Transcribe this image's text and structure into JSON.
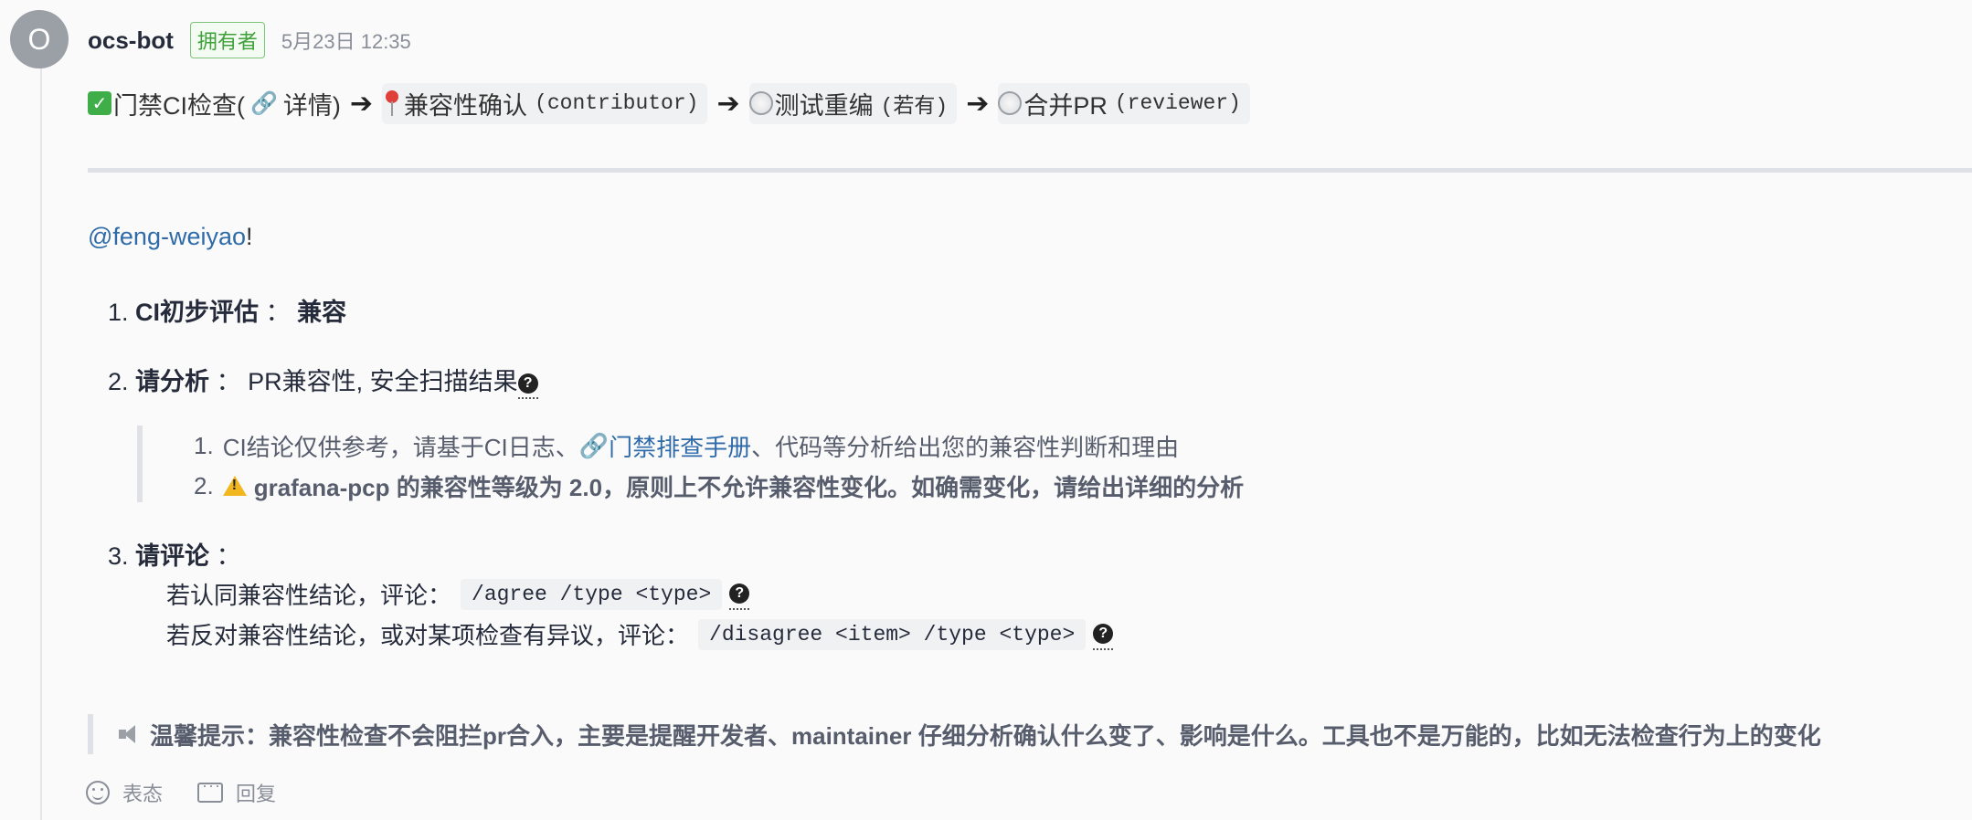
{
  "header": {
    "avatar_letter": "O",
    "author": "ocs-bot",
    "badge": "拥有者",
    "timestamp": "5月23日 12:35"
  },
  "pipeline": {
    "step1_label": "门禁CI检查(",
    "step1_link": "详情)",
    "step2_label": "兼容性确认",
    "step2_role": "(contributor)",
    "step3_label": "测试重编",
    "step3_role": "(若有)",
    "step4_label": "合并PR",
    "step4_role": "(reviewer)"
  },
  "mention": {
    "user": "@feng-weiyao",
    "suffix": "!"
  },
  "items": {
    "i1_num": "1.",
    "i1_title": "CI初步评估",
    "i1_sep": "：",
    "i1_value": "兼容",
    "i2_num": "2.",
    "i2_title": "请分析",
    "i2_sep": "：",
    "i2_value": "PR兼容性, 安全扫描结果",
    "i3_num": "3.",
    "i3_title": "请评论",
    "i3_sep": "："
  },
  "analysis": {
    "n1": "1.",
    "t1_a": "CI结论仅供参考，请基于CI日志、",
    "t1_link": "门禁排查手册",
    "t1_b": "、代码等分析给出您的兼容性判断和理由",
    "n2": "2.",
    "t2": "grafana-pcp 的兼容性等级为 2.0，原则上不允许兼容性变化。如确需变化，请给出详细的分析"
  },
  "comment_help": {
    "agree_prefix": "若认同兼容性结论，评论：",
    "agree_cmd": "/agree /type <type>",
    "disagree_prefix": "若反对兼容性结论，或对某项检查有异议，评论：",
    "disagree_cmd": "/disagree <item> /type <type>"
  },
  "tip": {
    "text": "温馨提示：兼容性检查不会阻拦pr合入，主要是提醒开发者、maintainer 仔细分析确认什么变了、影响是什么。工具也不是万能的，比如无法检查行为上的变化"
  },
  "actions": {
    "react": "表态",
    "reply": "回复"
  }
}
